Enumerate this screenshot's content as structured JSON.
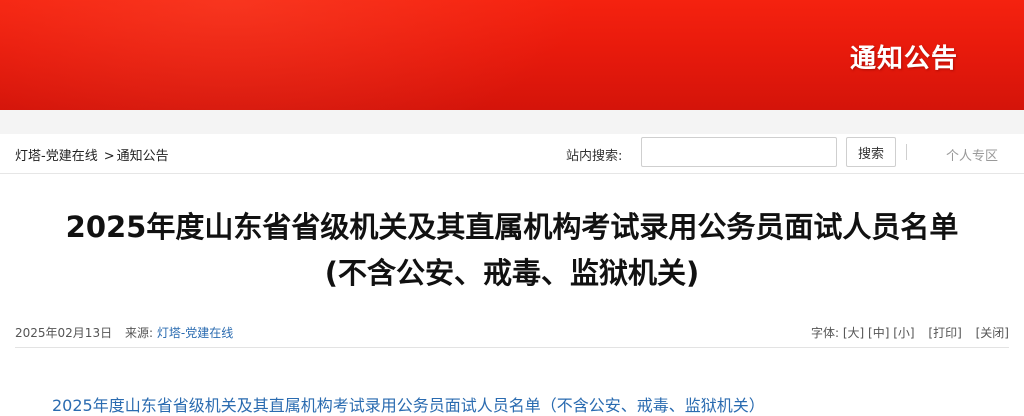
{
  "banner": {
    "title": "通知公告",
    "colors": {
      "top": "#f5220f",
      "bottom": "#d4140a"
    }
  },
  "breadcrumb": {
    "home": "灯塔-党建在线",
    "separator": ">",
    "current": "通知公告"
  },
  "search": {
    "label": "站内搜索:",
    "value": "",
    "button_label": "搜索"
  },
  "user": {
    "personal_area": "个人专区"
  },
  "article": {
    "title_line1": "2025年度山东省省级机关及其直属机构考试录用公务员面试人员名单",
    "title_line2": "(不含公安、戒毒、监狱机关)",
    "date": "2025年02月13日",
    "source_label": "来源:",
    "source_name": "灯塔-党建在线",
    "font_label": "字体:",
    "font_large": "[大]",
    "font_medium": "[中]",
    "font_small": "[小]",
    "print": "[打印]",
    "close": "[关闭]",
    "attachment_link": "2025年度山东省省级机关及其直属机构考试录用公务员面试人员名单（不含公安、戒毒、监狱机关）"
  },
  "colors": {
    "link": "#2a6bb0",
    "muted": "#999999"
  }
}
